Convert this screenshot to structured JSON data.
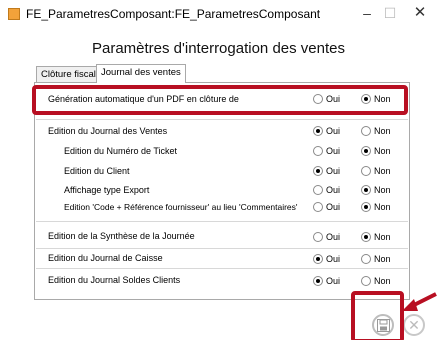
{
  "window": {
    "title": "FE_ParametresComposant:FE_ParametresComposant",
    "minimize_glyph": "–",
    "maximize_glyph": "☐",
    "close_glyph": "✕"
  },
  "dialog": {
    "title": "Paramètres d'interrogation des ventes"
  },
  "tabs": [
    {
      "label": "Clôture fiscale",
      "active": false
    },
    {
      "label": "Journal des ventes",
      "active": true
    }
  ],
  "options": {
    "oui": "Oui",
    "non": "Non"
  },
  "rows": [
    {
      "label": "Génération automatique d'un PDF en clôture de",
      "value": "Non"
    },
    {
      "label": "Edition du Journal des Ventes",
      "value": "Oui"
    },
    {
      "label": "Edition du Numéro de Ticket",
      "value": "Non"
    },
    {
      "label": "Edition du Client",
      "value": "Oui"
    },
    {
      "label": "Affichage type Export",
      "value": "Non"
    },
    {
      "label": "Edition 'Code + Référence fournisseur' au lieu 'Commentaires'",
      "value": "Non"
    },
    {
      "label": "Edition de la Synthèse de la Journée",
      "value": "Non"
    },
    {
      "label": "Edition du Journal de Caisse",
      "value": "Oui"
    },
    {
      "label": "Edition du Journal Soldes Clients",
      "value": "Oui"
    }
  ],
  "icons": {
    "save": "save-icon",
    "close": "close-icon",
    "arrow": "red-arrow"
  },
  "colors": {
    "highlight": "#b80f22",
    "app_icon": "#f2a23a"
  }
}
